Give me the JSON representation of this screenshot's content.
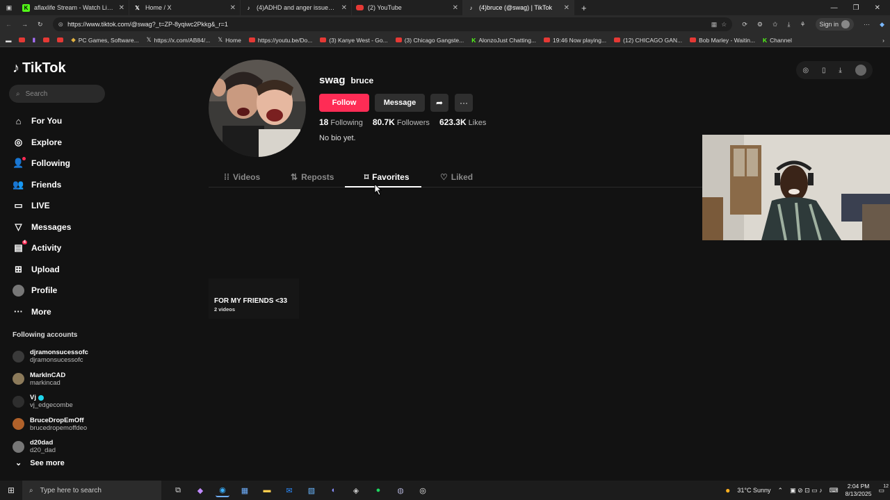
{
  "browser": {
    "tabs": [
      {
        "title": "aflaxlife Stream - Watch Live on K",
        "favicon": "K",
        "favicon_color": "#53fc18",
        "active": false
      },
      {
        "title": "Home / X",
        "favicon": "X",
        "favicon_color": "#ffffff",
        "active": false
      },
      {
        "title": "(4)ADHD and anger issues (ADHD",
        "favicon": "tiktok",
        "favicon_color": "#ffffff",
        "active": false
      },
      {
        "title": "(2) YouTube",
        "favicon": "youtube",
        "favicon_color": "#e53935",
        "active": false
      },
      {
        "title": "(4)bruce (@swag) | TikTok",
        "favicon": "tiktok",
        "favicon_color": "#ffffff",
        "active": true
      }
    ],
    "new_tab": "+",
    "url": "https://www.tiktok.com/@swag?_t=ZP-8yqiwc2Pkkg&_r=1",
    "signin_label": "Sign in",
    "bookmarks": [
      {
        "label": "",
        "icon": "youtube"
      },
      {
        "label": "",
        "icon": "twitch"
      },
      {
        "label": "",
        "icon": "youtube"
      },
      {
        "label": "",
        "icon": "youtube"
      },
      {
        "label": "PC Games, Software...",
        "icon": "game"
      },
      {
        "label": "https://x.com/AB84/...",
        "icon": "x"
      },
      {
        "label": "Home",
        "icon": "x"
      },
      {
        "label": "https://youtu.be/Do...",
        "icon": "youtube"
      },
      {
        "label": "(3) Kanye West - Go...",
        "icon": "youtube"
      },
      {
        "label": "(3) Chicago Gangste...",
        "icon": "youtube"
      },
      {
        "label": "AlonzoJust Chatting...",
        "icon": "kick"
      },
      {
        "label": "19:46 Now playing...",
        "icon": "youtube"
      },
      {
        "label": "(12) CHICAGO GAN...",
        "icon": "youtube"
      },
      {
        "label": "Bob Marley - Waitin...",
        "icon": "youtube"
      },
      {
        "label": "Channel",
        "icon": "kick"
      }
    ]
  },
  "tiktok": {
    "logo": "TikTok",
    "search_placeholder": "Search",
    "nav": [
      {
        "label": "For You",
        "icon": "home-icon",
        "glyph": "⌂"
      },
      {
        "label": "Explore",
        "icon": "compass-icon",
        "glyph": "◎"
      },
      {
        "label": "Following",
        "icon": "user-follow-icon",
        "glyph": "👤"
      },
      {
        "label": "Friends",
        "icon": "friends-icon",
        "glyph": "👥"
      },
      {
        "label": "LIVE",
        "icon": "live-icon",
        "glyph": "▭"
      },
      {
        "label": "Messages",
        "icon": "messages-icon",
        "glyph": "▽"
      },
      {
        "label": "Activity",
        "icon": "activity-icon",
        "glyph": "▤",
        "badge": "4"
      },
      {
        "label": "Upload",
        "icon": "upload-icon",
        "glyph": "⊞"
      },
      {
        "label": "Profile",
        "icon": "profile-avatar-icon",
        "glyph": "●"
      },
      {
        "label": "More",
        "icon": "more-icon",
        "glyph": "···"
      }
    ],
    "following_accounts_title": "Following accounts",
    "following_accounts": [
      {
        "name": "djramonsucessofc",
        "handle": "djramonsucessofc",
        "color": "#3a3a3a",
        "verified": false
      },
      {
        "name": "MarkInCAD",
        "handle": "markincad",
        "color": "#8c7a5a",
        "verified": false
      },
      {
        "name": "Vj",
        "handle": "vj_edgecombe",
        "color": "#2e2e2e",
        "verified": true
      },
      {
        "name": "BruceDropEmOff",
        "handle": "brucedropemoffdeo",
        "color": "#b0612a",
        "verified": false
      },
      {
        "name": "d20dad",
        "handle": "d20_dad",
        "color": "#777777",
        "verified": false
      }
    ],
    "see_more": "See more",
    "profile": {
      "username": "swag",
      "nickname": "bruce",
      "follow_label": "Follow",
      "message_label": "Message",
      "following_count": "18",
      "following_label": "Following",
      "followers_count": "80.7K",
      "followers_label": "Followers",
      "likes_count": "623.3K",
      "likes_label": "Likes",
      "bio": "No bio yet."
    },
    "tabs": [
      {
        "label": "Videos",
        "icon": "grid-icon",
        "active": false
      },
      {
        "label": "Reposts",
        "icon": "repost-icon",
        "active": false
      },
      {
        "label": "Favorites",
        "icon": "bookmark-icon",
        "active": true
      },
      {
        "label": "Liked",
        "icon": "heart-icon",
        "active": false
      }
    ],
    "collection": {
      "title": "FOR MY FRIENDS <33",
      "count": "2 videos"
    }
  },
  "taskbar": {
    "search_placeholder": "Type here to search",
    "weather": "31°C  Sunny",
    "time": "2:04 PM",
    "date": "8/13/2025",
    "notifications": "12"
  },
  "colors": {
    "accent": "#fe2c55",
    "background": "#121212"
  }
}
